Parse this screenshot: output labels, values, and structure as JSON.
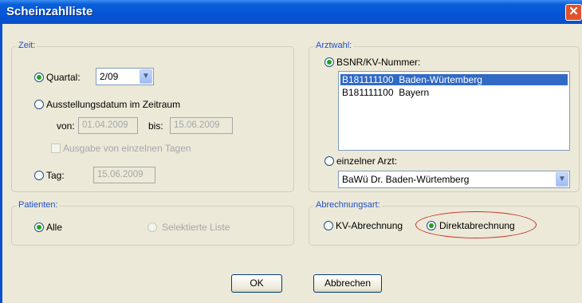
{
  "window": {
    "title": "Scheinzahlliste"
  },
  "zeit": {
    "legend": "Zeit:",
    "quartal_label": "Quartal:",
    "quartal_value": "2/09",
    "ausstellungsdatum_label": "Ausstellungsdatum im Zeitraum",
    "von_label": "von:",
    "von_value": "01.04.2009",
    "bis_label": "bis:",
    "bis_value": "15.06.2009",
    "einzelne_tage_label": "Ausgabe von einzelnen Tagen",
    "tag_label": "Tag:",
    "tag_value": "15.06.2009"
  },
  "patienten": {
    "legend": "Patienten:",
    "alle_label": "Alle",
    "selektierte_label": "Selektierte Liste"
  },
  "arztwahl": {
    "legend": "Arztwahl:",
    "bsnr_label": "BSNR/KV-Nummer:",
    "list": [
      {
        "nr": "B181111100",
        "region": "Baden-Würtemberg"
      },
      {
        "nr": "B181111100",
        "region": "Bayern"
      }
    ],
    "einzelner_arzt_label": "einzelner Arzt:",
    "arzt_value": "BaWü  Dr. Baden-Würtemberg"
  },
  "abrechnungsart": {
    "legend": "Abrechnungsart:",
    "kv_label": "KV-Abrechnung",
    "direkt_label": "Direktabrechnung"
  },
  "buttons": {
    "ok": "OK",
    "abbrechen": "Abbrechen"
  },
  "colors": {
    "titlebar": "#0554d8",
    "accent_group_label": "#1f4fc8",
    "selection": "#316ac5",
    "annotation": "#c4302b"
  }
}
